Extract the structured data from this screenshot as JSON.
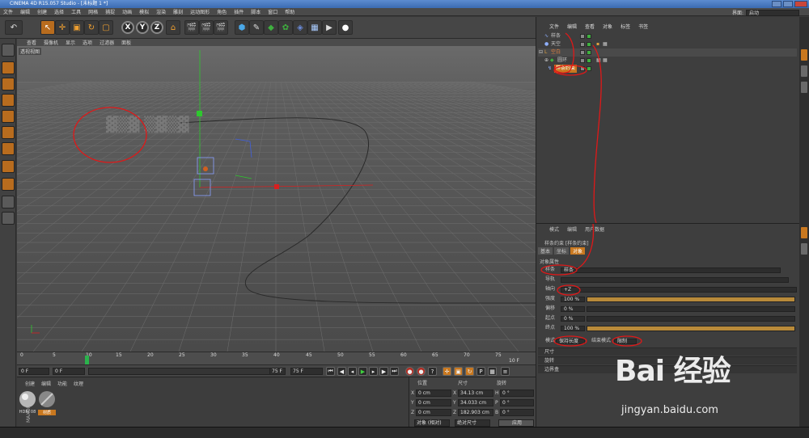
{
  "window": {
    "title": "CINEMA 4D R15.057 Studio - [未标题 1 *]"
  },
  "menubar": {
    "items": [
      "文件",
      "编辑",
      "创建",
      "选择",
      "工具",
      "网格",
      "捕捉",
      "动画",
      "模拟",
      "渲染",
      "雕刻",
      "运动图形",
      "角色",
      "插件",
      "脚本",
      "窗口",
      "帮助"
    ],
    "layout_label": "界面:",
    "layout_value": "启动"
  },
  "toolbar": {
    "icons": [
      "undo-icon",
      "select-arrow-icon",
      "move-icon",
      "scale-icon",
      "rotate-icon",
      "recent-tool-icon",
      "x-axis-icon",
      "y-axis-icon",
      "z-axis-icon",
      "world-coord-icon",
      "render-view-icon",
      "render-picture-icon",
      "edit-render-settings-icon",
      "cube-icon",
      "pen-spline-icon",
      "subdivision-icon",
      "array-icon",
      "deformer-icon",
      "floor-icon",
      "camera-icon",
      "light-icon"
    ],
    "axis_labels": [
      "X",
      "Y",
      "Z"
    ]
  },
  "viewport": {
    "menu": [
      "查看",
      "摄像机",
      "显示",
      "选项",
      "过滤器",
      "面板"
    ],
    "label": "透视视图"
  },
  "timeline": {
    "ticks": [
      "0",
      "5",
      "10",
      "15",
      "20",
      "25",
      "30",
      "35",
      "40",
      "45",
      "50",
      "55",
      "60",
      "65",
      "70",
      "75"
    ],
    "end_label": "10 F"
  },
  "transport": {
    "start": "0 F",
    "min": "0 F",
    "max1": "75 F",
    "max2": "75 F"
  },
  "material_manager": {
    "menu": [
      "创建",
      "编辑",
      "功能",
      "纹理"
    ],
    "materials": [
      "HDRI 08",
      "材质"
    ]
  },
  "coord_manager": {
    "headers": [
      "位置",
      "尺寸",
      "旋转"
    ],
    "rows": [
      {
        "axis": "X",
        "pos": "0 cm",
        "size_axis": "X",
        "size": "34.13 cm",
        "rot_axis": "H",
        "rot": "0 °"
      },
      {
        "axis": "Y",
        "pos": "0 cm",
        "size_axis": "Y",
        "size": "34.033 cm",
        "rot_axis": "P",
        "rot": "0 °"
      },
      {
        "axis": "Z",
        "pos": "0 cm",
        "size_axis": "Z",
        "size": "182.903 cm",
        "rot_axis": "B",
        "rot": "0 °"
      }
    ],
    "mode1": "对象 (相对)",
    "mode2": "绝对尺寸",
    "apply": "应用"
  },
  "object_manager": {
    "menu": [
      "文件",
      "编辑",
      "查看",
      "对象",
      "标签",
      "书签"
    ],
    "objects": [
      {
        "name": "样条",
        "indent": 0,
        "selected": false
      },
      {
        "name": "天空",
        "indent": 0,
        "selected": false
      },
      {
        "name": "空白",
        "indent": 0,
        "selected": false,
        "orange": true
      },
      {
        "name": "圆环",
        "indent": 1,
        "selected": false
      },
      {
        "name": "样条约束",
        "indent": 1,
        "selected": true
      }
    ]
  },
  "attribute_manager": {
    "menu": [
      "模式",
      "编辑",
      "用户数据"
    ],
    "header": "样条约束 [样条约束]",
    "tabs": [
      "基本",
      "坐标",
      "对象"
    ],
    "section_title": "对象属性",
    "fields": [
      {
        "label": "样条",
        "value": "样条",
        "type": "link"
      },
      {
        "label": "导轨",
        "value": "",
        "type": "link"
      },
      {
        "label": "轴向",
        "value": "+Z",
        "type": "select"
      },
      {
        "label": "强度",
        "value": "100 %",
        "type": "slider",
        "fill": 1.0
      },
      {
        "label": "偏移",
        "value": "0 %",
        "type": "slider",
        "fill": 0.0
      },
      {
        "label": "起点",
        "value": "0 %",
        "type": "slider",
        "fill": 0.0
      },
      {
        "label": "终点",
        "value": "100 %",
        "type": "slider",
        "fill": 1.0
      }
    ],
    "mode_label": "模式",
    "mode_value": "保持长度",
    "end_mode_label": "结束模式",
    "end_mode_value": "限制",
    "sections": [
      "尺寸",
      "旋转",
      "边界盒"
    ]
  },
  "watermark": {
    "logo": "Bai 经验",
    "url": "jingyan.baidu.com"
  },
  "colors": {
    "accent": "#c9781f",
    "spline": "#2a2a2a",
    "grid": "#666666",
    "annotation": "#e01818"
  }
}
